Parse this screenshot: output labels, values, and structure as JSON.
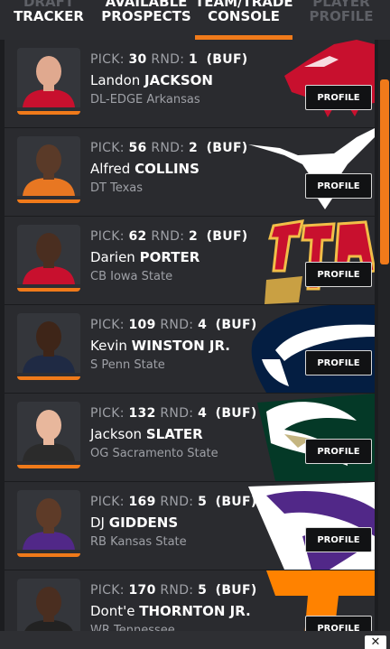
{
  "tabs": [
    {
      "line1": "DRAFT",
      "line2": "TRACKER"
    },
    {
      "line1": "AVAILABLE",
      "line2": "PROSPECTS"
    },
    {
      "line1": "TEAM/TRADE",
      "line2": "CONSOLE"
    },
    {
      "line1": "PLAYER",
      "line2": "PROFILE"
    }
  ],
  "labels": {
    "pick": "PICK:",
    "round": "RND:",
    "profile": "PROFILE",
    "close": "✕"
  },
  "picks": [
    {
      "pick": "30",
      "round": "1",
      "team": "(BUF)",
      "first": "Landon",
      "last": "JACKSON",
      "position": "DL-EDGE",
      "school": "Arkansas",
      "logo": "arkansas-razorback-logo"
    },
    {
      "pick": "56",
      "round": "2",
      "team": "(BUF)",
      "first": "Alfred",
      "last": "COLLINS",
      "position": "DT",
      "school": "Texas",
      "logo": "texas-longhorn-logo"
    },
    {
      "pick": "62",
      "round": "2",
      "team": "(BUF)",
      "first": "Darien",
      "last": "PORTER",
      "position": "CB",
      "school": "Iowa State",
      "logo": "iowa-state-logo"
    },
    {
      "pick": "109",
      "round": "4",
      "team": "(BUF)",
      "first": "Kevin",
      "last": "WINSTON JR.",
      "position": "S",
      "school": "Penn State",
      "logo": "penn-state-logo"
    },
    {
      "pick": "132",
      "round": "4",
      "team": "(BUF)",
      "first": "Jackson",
      "last": "SLATER",
      "position": "OG",
      "school": "Sacramento State",
      "logo": "sacramento-state-logo"
    },
    {
      "pick": "169",
      "round": "5",
      "team": "(BUF)",
      "first": "DJ",
      "last": "GIDDENS",
      "position": "RB",
      "school": "Kansas State",
      "logo": "kansas-state-logo"
    },
    {
      "pick": "170",
      "round": "5",
      "team": "(BUF)",
      "first": "Dont'e",
      "last": "THORNTON JR.",
      "position": "WR",
      "school": "Tennessee",
      "logo": "tennessee-logo"
    }
  ],
  "colors": {
    "accent": "#f07a1a",
    "rowBg": "#2a2b2f",
    "muted": "#9ea0a6"
  }
}
